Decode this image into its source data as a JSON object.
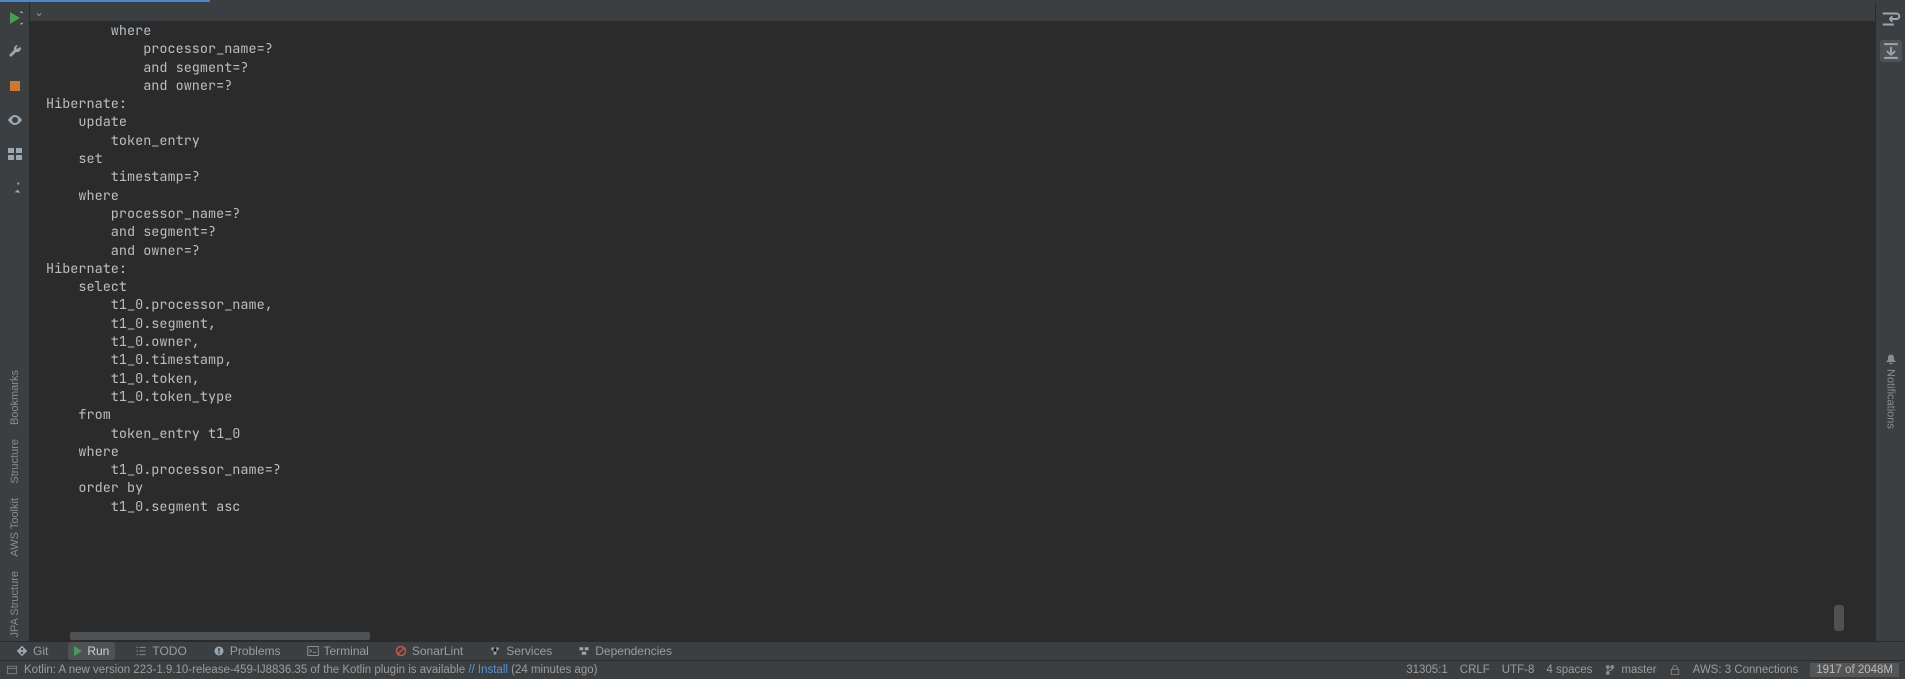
{
  "console_output": "        where\n            processor_name=?\n            and segment=?\n            and owner=?\nHibernate:\n    update\n        token_entry\n    set\n        timestamp=?\n    where\n        processor_name=?\n        and segment=?\n        and owner=?\nHibernate:\n    select\n        t1_0.processor_name,\n        t1_0.segment,\n        t1_0.owner,\n        t1_0.timestamp,\n        t1_0.token,\n        t1_0.token_type\n    from\n        token_entry t1_0\n    where\n        t1_0.processor_name=?\n    order by\n        t1_0.segment asc",
  "left_tools": {
    "bookmarks": "Bookmarks",
    "structure": "Structure",
    "aws_toolkit": "AWS Toolkit",
    "jpa_structure": "JPA Structure"
  },
  "right_tools": {
    "notifications": "Notifications"
  },
  "bottom_tabs": {
    "git": "Git",
    "run": "Run",
    "todo": "TODO",
    "problems": "Problems",
    "terminal": "Terminal",
    "sonarlint": "SonarLint",
    "services": "Services",
    "dependencies": "Dependencies"
  },
  "status": {
    "kotlin_msg_pre": "Kotlin: A new version 223-1.9.10-release-459-IJ8836.35 of the Kotlin plugin is available ",
    "kotlin_install": "// Install",
    "kotlin_msg_post": " (24 minutes ago)",
    "caret": "31305:1",
    "line_sep": "CRLF",
    "encoding": "UTF-8",
    "indent": "4 spaces",
    "branch": "master",
    "aws": "AWS: 3 Connections",
    "memory": "1917 of 2048M"
  }
}
